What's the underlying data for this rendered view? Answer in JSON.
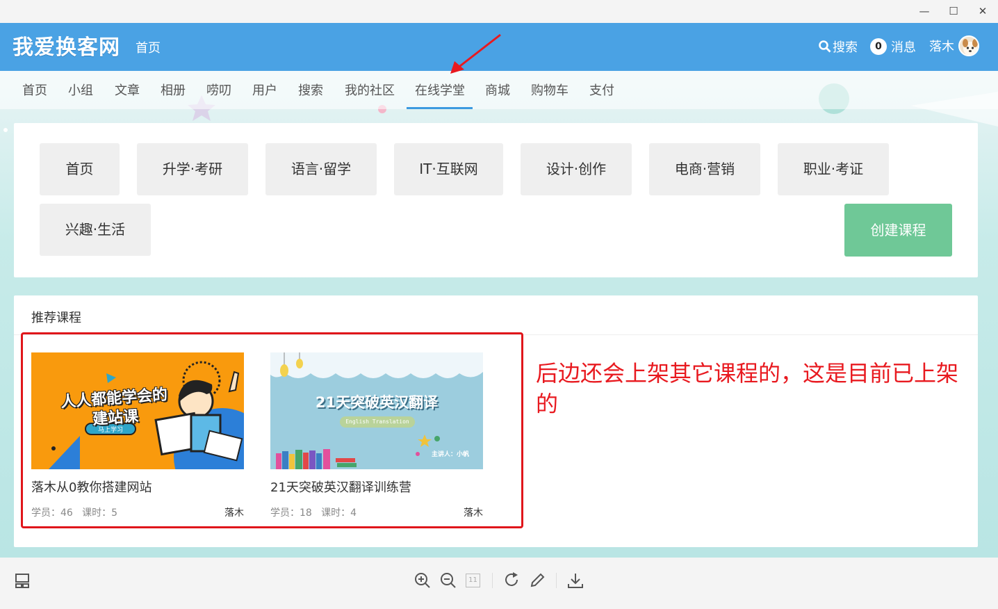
{
  "window": {
    "minimize": "—",
    "maximize": "☐",
    "close": "✕"
  },
  "header": {
    "logo": "我爱换客网",
    "home": "首页",
    "search": "搜索",
    "messages_count": "0",
    "messages": "消息",
    "username": "落木"
  },
  "nav": {
    "items": [
      "首页",
      "小组",
      "文章",
      "相册",
      "唠叨",
      "用户",
      "搜索",
      "我的社区",
      "在线学堂",
      "商城",
      "购物车",
      "支付"
    ],
    "active": "在线学堂"
  },
  "categories": {
    "items": [
      "首页",
      "升学·考研",
      "语言·留学",
      "IT·互联网",
      "设计·创作",
      "电商·营销",
      "职业·考证",
      "兴趣·生活"
    ],
    "create": "创建课程"
  },
  "recommended": {
    "title": "推荐课程",
    "courses": [
      {
        "name": "落木从0教你搭建网站",
        "meta": "学员：46   课时：5",
        "author": "落木",
        "thumb_line1": "人人都能学会的",
        "thumb_line2": "建站课",
        "thumb_tag": "马上学习"
      },
      {
        "name": "21天突破英汉翻译训练营",
        "meta": "学员：18   课时：4",
        "author": "落木",
        "thumb_title": "21天突破英汉翻译",
        "thumb_sub": "English Translation",
        "thumb_speaker": "主讲人：小帆"
      }
    ]
  },
  "annotation": "后边还会上架其它课程的，这是目前已上架的",
  "toolbar": {
    "page_number": "11"
  },
  "colors": {
    "header": "#4aa2e4",
    "create_button": "#6fc897",
    "annotation": "#e8191f"
  }
}
